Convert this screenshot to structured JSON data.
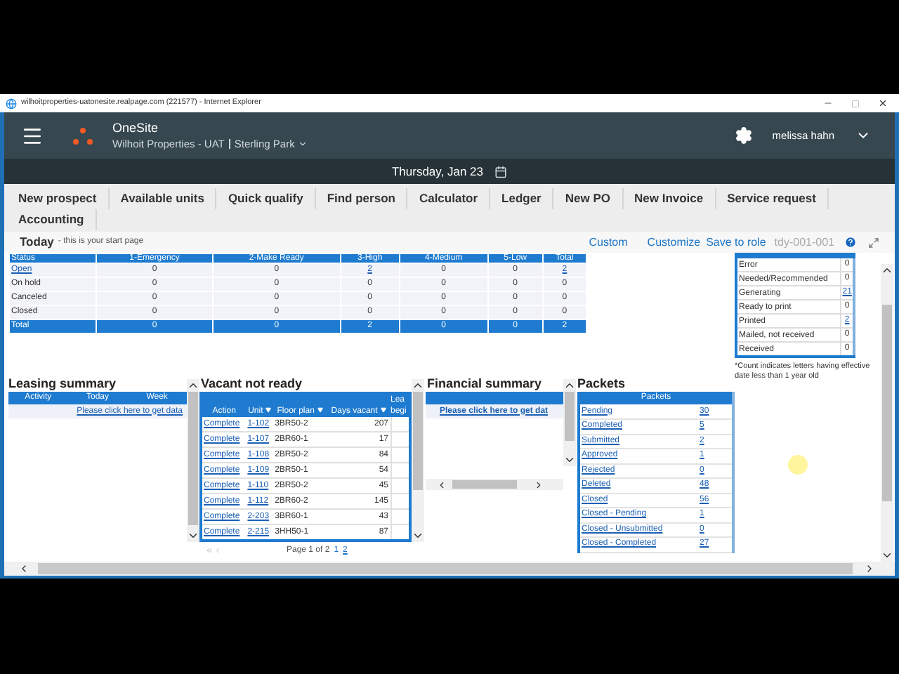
{
  "browser": {
    "title": "wilhoitproperties-uatonesite.realpage.com (221577) - Internet Explorer"
  },
  "header": {
    "app_name": "OneSite",
    "property": "Wilhoit Properties - UAT",
    "site": "Sterling Park",
    "user": "melissa hahn"
  },
  "date": "Thursday, Jan 23",
  "quick_links": [
    "New prospect",
    "Available units",
    "Quick qualify",
    "Find person",
    "Calculator",
    "Ledger",
    "New PO",
    "New Invoice",
    "Service request",
    "Accounting"
  ],
  "today": {
    "title": "Today",
    "subtitle": "- this is your start page",
    "links": [
      "Custom",
      "Customize",
      "Save to role"
    ],
    "code": "tdy-001-001"
  },
  "work_orders": {
    "columns": [
      "Status",
      "1-Emergency",
      "2-Make Ready",
      "3-High",
      "4-Medium",
      "5-Low",
      "Total"
    ],
    "rows": [
      {
        "kind": "data",
        "cells": [
          {
            "text": "Open",
            "link": true
          },
          {
            "text": "0",
            "link": false
          },
          {
            "text": "0",
            "link": false
          },
          {
            "text": "2",
            "link": true
          },
          {
            "text": "0",
            "link": false
          },
          {
            "text": "0",
            "link": false
          },
          {
            "text": "2",
            "link": true
          }
        ]
      },
      {
        "kind": "data",
        "cells": [
          {
            "text": "On hold",
            "link": false
          },
          {
            "text": "0",
            "link": false
          },
          {
            "text": "0",
            "link": false
          },
          {
            "text": "0",
            "link": false
          },
          {
            "text": "0",
            "link": false
          },
          {
            "text": "0",
            "link": false
          },
          {
            "text": "0",
            "link": false
          }
        ]
      },
      {
        "kind": "data",
        "cells": [
          {
            "text": "Canceled",
            "link": false
          },
          {
            "text": "0",
            "link": false
          },
          {
            "text": "0",
            "link": false
          },
          {
            "text": "0",
            "link": false
          },
          {
            "text": "0",
            "link": false
          },
          {
            "text": "0",
            "link": false
          },
          {
            "text": "0",
            "link": false
          }
        ]
      },
      {
        "kind": "data",
        "cells": [
          {
            "text": "Closed",
            "link": false
          },
          {
            "text": "0",
            "link": false
          },
          {
            "text": "0",
            "link": false
          },
          {
            "text": "0",
            "link": false
          },
          {
            "text": "0",
            "link": false
          },
          {
            "text": "0",
            "link": false
          },
          {
            "text": "0",
            "link": false
          }
        ]
      },
      {
        "kind": "total",
        "cells": [
          {
            "text": "Total",
            "link": false
          },
          {
            "text": "0",
            "link": false
          },
          {
            "text": "0",
            "link": false
          },
          {
            "text": "2",
            "link": false
          },
          {
            "text": "0",
            "link": false
          },
          {
            "text": "0",
            "link": false
          },
          {
            "text": "2",
            "link": false
          }
        ]
      }
    ]
  },
  "letters": {
    "rows": [
      {
        "label": "Error",
        "count": "0",
        "link": false
      },
      {
        "label": "Needed/Recommended",
        "count": "0",
        "link": false
      },
      {
        "label": "Generating",
        "count": "21",
        "link": true
      },
      {
        "label": "Ready to print",
        "count": "0",
        "link": false
      },
      {
        "label": "Printed",
        "count": "2",
        "link": true
      },
      {
        "label": "Mailed, not received",
        "count": "0",
        "link": false
      },
      {
        "label": "Received",
        "count": "0",
        "link": false
      }
    ],
    "note": "*Count indicates letters having effective date less than 1 year old"
  },
  "leasing_summary": {
    "title": "Leasing summary",
    "columns": [
      "Activity",
      "Today",
      "Week"
    ],
    "link": "Please click here to get data"
  },
  "vacant_not_ready": {
    "title": "Vacant not ready",
    "columns": [
      "Action",
      "Unit",
      "Floor plan",
      "Days vacant",
      "Lea begi"
    ],
    "rows": [
      {
        "action": "Complete",
        "unit": "1-102",
        "floor_plan": "3BR50-2",
        "days_vacant": "207"
      },
      {
        "action": "Complete",
        "unit": "1-107",
        "floor_plan": "2BR60-1",
        "days_vacant": "17"
      },
      {
        "action": "Complete",
        "unit": "1-108",
        "floor_plan": "2BR50-2",
        "days_vacant": "84"
      },
      {
        "action": "Complete",
        "unit": "1-109",
        "floor_plan": "2BR50-1",
        "days_vacant": "54"
      },
      {
        "action": "Complete",
        "unit": "1-110",
        "floor_plan": "2BR50-2",
        "days_vacant": "45"
      },
      {
        "action": "Complete",
        "unit": "1-112",
        "floor_plan": "2BR60-2",
        "days_vacant": "145"
      },
      {
        "action": "Complete",
        "unit": "2-203",
        "floor_plan": "3BR60-1",
        "days_vacant": "43"
      },
      {
        "action": "Complete",
        "unit": "2-215",
        "floor_plan": "3HH50-1",
        "days_vacant": "87"
      }
    ],
    "pager": "Page 1 of 2",
    "pages": [
      {
        "label": "1",
        "selected": true
      },
      {
        "label": "2",
        "selected": false
      }
    ]
  },
  "financial_summary": {
    "title": "Financial summary",
    "link": "Please click here to get dat"
  },
  "packets": {
    "title": "Packets",
    "header": "Packets",
    "rows": [
      {
        "label": "Pending",
        "count": "30"
      },
      {
        "label": "Completed",
        "count": "5"
      },
      {
        "label": "Submitted",
        "count": "2"
      },
      {
        "label": "Approved",
        "count": "1"
      },
      {
        "label": "Rejected",
        "count": "0"
      },
      {
        "label": "Deleted",
        "count": "48"
      },
      {
        "label": "Closed",
        "count": "56"
      },
      {
        "label": "Closed - Pending",
        "count": "1"
      },
      {
        "label": "Closed - Unsubmitted",
        "count": "0"
      },
      {
        "label": "Closed - Completed",
        "count": "27"
      }
    ]
  }
}
